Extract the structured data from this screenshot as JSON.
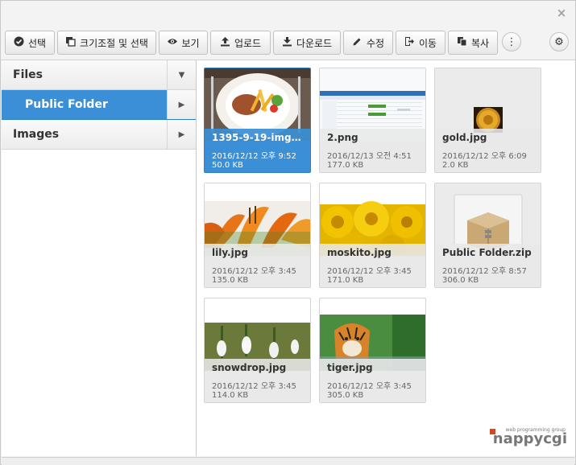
{
  "window": {
    "close_glyph": "×"
  },
  "toolbar": {
    "select": "선택",
    "resize_select": "크기조절 및 선택",
    "view": "보기",
    "upload": "업로드",
    "download": "다운로드",
    "edit": "수정",
    "move": "이동",
    "copy": "복사",
    "more_glyph": "⋮",
    "settings_glyph": "⚙"
  },
  "sidebar": {
    "items": [
      {
        "label": "Files",
        "arrow": "▼",
        "active": false
      },
      {
        "label": "Public Folder",
        "arrow": "▶",
        "active": true
      },
      {
        "label": "Images",
        "arrow": "▶",
        "active": false
      }
    ]
  },
  "files": [
    {
      "name": "1395-9-19-img4....",
      "date": "2016/12/12 오후 9:52",
      "size": "50.0 KB",
      "selected": true,
      "thumb": "food"
    },
    {
      "name": "2.png",
      "date": "2016/12/13 오전 4:51",
      "size": "177.0 KB",
      "selected": false,
      "thumb": "spreadsheet"
    },
    {
      "name": "gold.jpg",
      "date": "2016/12/12 오후 6:09",
      "size": "2.0 KB",
      "selected": false,
      "thumb": "coin"
    },
    {
      "name": "lily.jpg",
      "date": "2016/12/12 오후 3:45",
      "size": "135.0 KB",
      "selected": false,
      "thumb": "lily"
    },
    {
      "name": "moskito.jpg",
      "date": "2016/12/12 오후 3:45",
      "size": "171.0 KB",
      "selected": false,
      "thumb": "yellow-flowers"
    },
    {
      "name": "Public Folder.zip",
      "date": "2016/12/12 오후 8:57",
      "size": "306.0 KB",
      "selected": false,
      "thumb": "zip"
    },
    {
      "name": "snowdrop.jpg",
      "date": "2016/12/12 오후 3:45",
      "size": "114.0 KB",
      "selected": false,
      "thumb": "snowdrop"
    },
    {
      "name": "tiger.jpg",
      "date": "2016/12/12 오후 3:45",
      "size": "305.0 KB",
      "selected": false,
      "thumb": "tiger"
    }
  ],
  "logo": {
    "tagline": "web programming group",
    "brand": "nappycgi"
  }
}
